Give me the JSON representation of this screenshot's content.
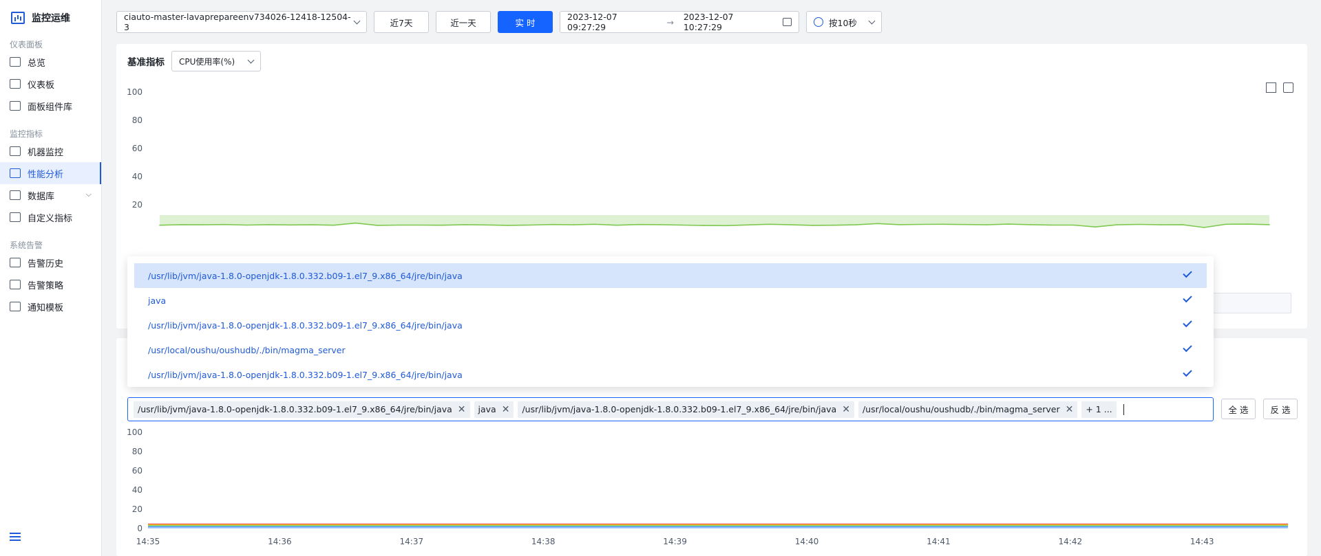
{
  "sidebar": {
    "app_title": "监控运维",
    "groups": [
      {
        "title": "仪表面板",
        "items": [
          {
            "label": "总览",
            "icon": "home-icon"
          },
          {
            "label": "仪表板",
            "icon": "dashboard-icon"
          },
          {
            "label": "面板组件库",
            "icon": "widget-library-icon"
          }
        ]
      },
      {
        "title": "监控指标",
        "items": [
          {
            "label": "机器监控",
            "icon": "machine-monitor-icon"
          },
          {
            "label": "性能分析",
            "icon": "performance-icon",
            "active": true
          },
          {
            "label": "数据库",
            "icon": "database-icon",
            "expandable": true
          },
          {
            "label": "自定义指标",
            "icon": "custom-metric-icon"
          }
        ]
      },
      {
        "title": "系统告警",
        "items": [
          {
            "label": "告警历史",
            "icon": "alert-history-icon"
          },
          {
            "label": "告警策略",
            "icon": "alert-policy-icon"
          },
          {
            "label": "通知模板",
            "icon": "notify-template-icon"
          }
        ]
      }
    ]
  },
  "toolbar": {
    "instance": "ciauto-master-lavaprepareenv734026-12418-12504-3",
    "btn_7days": "近7天",
    "btn_1day": "近一天",
    "btn_realtime": "实 时",
    "range_start": "2023-12-07 09:27:29",
    "range_arrow": "→",
    "range_end": "2023-12-07 10:27:29",
    "interval": "按10秒"
  },
  "panel1": {
    "metric_label": "基准指标",
    "metric_value": "CPU使用率(%)"
  },
  "dropdown": {
    "options": [
      "/usr/lib/jvm/java-1.8.0-openjdk-1.8.0.332.b09-1.el7_9.x86_64/jre/bin/java",
      "java",
      "/usr/lib/jvm/java-1.8.0-openjdk-1.8.0.332.b09-1.el7_9.x86_64/jre/bin/java",
      "/usr/local/oushu/oushudb/./bin/magma_server",
      "/usr/lib/jvm/java-1.8.0-openjdk-1.8.0.332.b09-1.el7_9.x86_64/jre/bin/java"
    ]
  },
  "tags": {
    "items": [
      "/usr/lib/jvm/java-1.8.0-openjdk-1.8.0.332.b09-1.el7_9.x86_64/jre/bin/java",
      "java",
      "/usr/lib/jvm/java-1.8.0-openjdk-1.8.0.332.b09-1.el7_9.x86_64/jre/bin/java",
      "/usr/local/oushu/oushudb/./bin/magma_server"
    ],
    "more": "+ 1 ...",
    "select_all": "全 选",
    "invert": "反 选"
  },
  "colors": {
    "accent": "#1664ff",
    "series_green": "#7ec850"
  },
  "chart_data": [
    {
      "type": "area",
      "yticks": [
        "100",
        "80",
        "60",
        "40",
        "20"
      ],
      "ylim": [
        0,
        100
      ],
      "series": [
        {
          "values": [
            5.5,
            5.9,
            5.8,
            6.0,
            5.6,
            5.9,
            5.7,
            5.8,
            5.5,
            7.0,
            5.4,
            5.6,
            5.6,
            5.5,
            5.9,
            5.7,
            5.4,
            5.6,
            6.0,
            5.8,
            6.2,
            5.5,
            6.0,
            5.9,
            5.6,
            5.3,
            5.2,
            5.7,
            6.2,
            5.8,
            5.4,
            5.5,
            5.8,
            6.7,
            5.9,
            6.1,
            6.2,
            6.0,
            5.8,
            6.3,
            5.9,
            5.6,
            5.6,
            4.3,
            5.8,
            6.1,
            5.8,
            5.9,
            3.9,
            6.2,
            6.3,
            5.9
          ]
        }
      ]
    },
    {
      "type": "line",
      "yticks": [
        "100",
        "80",
        "60",
        "40",
        "20",
        "0"
      ],
      "ylim": [
        0,
        100
      ],
      "x_labels": [
        "14:35",
        "14:36",
        "14:37",
        "14:38",
        "14:39",
        "14:40",
        "14:41",
        "14:42",
        "14:43"
      ],
      "series": [
        {
          "values": [
            4.5,
            4.5,
            4.5,
            4.5,
            4.5,
            4.5,
            4.5,
            4.5,
            4.5
          ],
          "color": "#e8684a"
        },
        {
          "values": [
            3.5,
            3.5,
            3.5,
            3.5,
            3.5,
            3.5,
            3.5,
            3.5,
            3.5
          ],
          "color": "#f6bd16"
        },
        {
          "values": [
            2.5,
            2.5,
            2.5,
            2.5,
            2.5,
            2.5,
            2.5,
            2.5,
            2.5
          ],
          "color": "#5ad8a6"
        },
        {
          "values": [
            1.5,
            1.5,
            1.5,
            1.5,
            1.5,
            1.5,
            1.5,
            1.5,
            1.5
          ],
          "color": "#5b8ff9"
        },
        {
          "values": [
            0.8,
            0.8,
            0.8,
            0.8,
            0.8,
            0.8,
            0.8,
            0.8,
            0.8
          ],
          "color": "#9ec4ff"
        }
      ]
    }
  ]
}
